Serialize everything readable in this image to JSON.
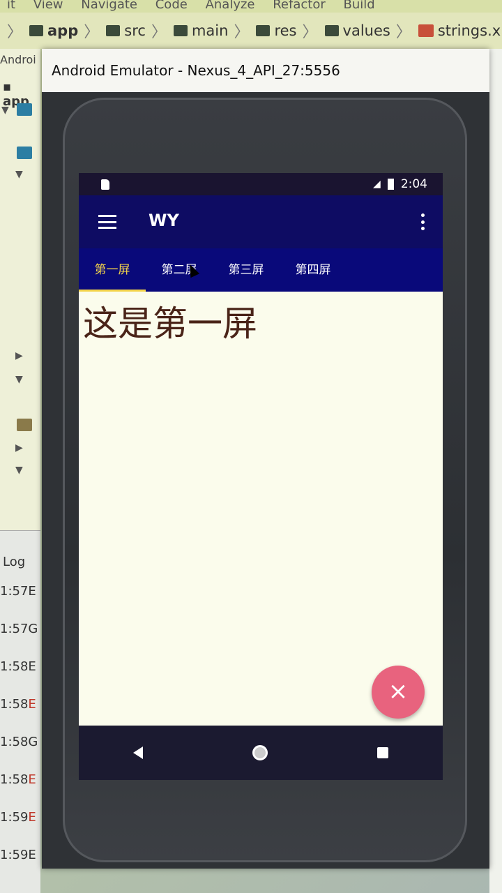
{
  "ide": {
    "menu": [
      "it",
      "View",
      "Navigate",
      "Code",
      "Analyze",
      "Refactor",
      "Build"
    ],
    "breadcrumb": [
      "app",
      "src",
      "main",
      "res",
      "values",
      "strings.xml"
    ],
    "left_panel": {
      "top_label": "Androi",
      "project_label": "app"
    },
    "log": {
      "title": "Log",
      "rows": [
        "1:57",
        "1:57",
        "1:58",
        "1:58",
        "1:58",
        "1:58",
        "1:59",
        "1:59"
      ],
      "row_tags": [
        "E",
        "G",
        "E",
        "E",
        "G",
        "E",
        "E",
        "E"
      ]
    }
  },
  "emulator": {
    "window_title": "Android Emulator - Nexus_4_API_27:5556"
  },
  "phone": {
    "status_time": "2:04",
    "app_title": "WY",
    "tabs": [
      "第一屏",
      "第二屏",
      "第三屏",
      "第四屏"
    ],
    "active_tab": 0,
    "content_text": "这是第一屏",
    "fab_label": "×"
  },
  "colors": {
    "toolbar": "#0e0c63",
    "tabbar": "#09097a",
    "active_tab": "#f4d44a",
    "fab": "#e8637e",
    "content_text": "#4a2418"
  }
}
